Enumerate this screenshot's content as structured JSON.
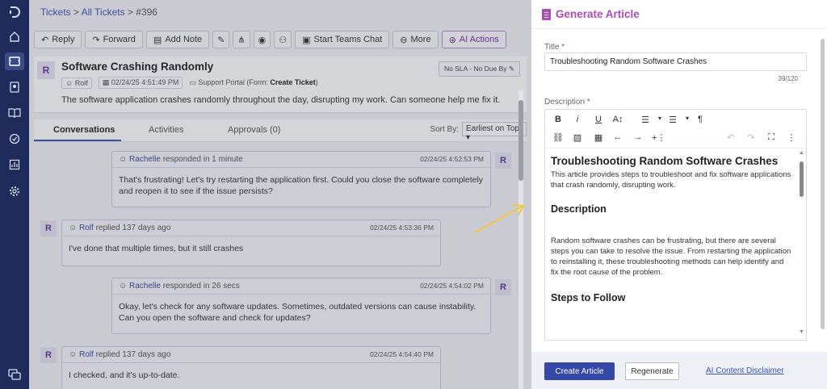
{
  "breadcrumb": {
    "tickets": "Tickets",
    "sep1": " > ",
    "all": "All Tickets",
    "sep2": " > ",
    "current": "#396"
  },
  "toolbar": {
    "reply": "Reply",
    "forward": "Forward",
    "add_note": "Add Note",
    "teams": "Start Teams Chat",
    "more": "More",
    "ai": "AI Actions"
  },
  "ticket": {
    "avatar": "R",
    "title": "Software Crashing Randomly",
    "requester": "Rolf",
    "created": "02/24/25 4:51:49 PM",
    "source_prefix": "Support Portal (Form: ",
    "source_form": "Create Ticket",
    "source_suffix": ")",
    "sla": "No SLA - No Due By",
    "description": "The software application crashes randomly throughout the day, disrupting my work. Can someone help me fix it."
  },
  "tabs": {
    "conversations": "Conversations",
    "activities": "Activities",
    "approvals": "Approvals (0)",
    "sort_label": "Sort By:",
    "sort_value": "Earliest on Top"
  },
  "messages": [
    {
      "avatar": "R",
      "name": "Rachelle",
      "action": " responded in 1 minute",
      "time": "02/24/25 4:52:53 PM",
      "body": "That's frustrating! Let's try restarting the application first. Could you close the software completely and reopen it to see if the issue persists?"
    },
    {
      "avatar": "R",
      "name": "Rolf",
      "action": " replied 137 days ago",
      "time": "02/24/25 4:53:36 PM",
      "body": "I've done that multiple times, but it still crashes"
    },
    {
      "avatar": "R",
      "name": "Rachelle",
      "action": " responded in 26 secs",
      "time": "02/24/25 4:54:02 PM",
      "body": "Okay, let's check for any software updates. Sometimes, outdated versions can cause instability. Can you open the software and check for updates?"
    },
    {
      "avatar": "R",
      "name": "Rolf",
      "action": " replied 137 days ago",
      "time": "02/24/25 4:54:40 PM",
      "body": "I checked, and it's up-to-date."
    }
  ],
  "panel": {
    "title": "Generate Article",
    "title_label": "Title *",
    "title_value": "Troubleshooting Random Software Crashes",
    "counter": "39/120",
    "description_label": "Description *",
    "editor": {
      "h1": "Troubleshooting Random Software Crashes",
      "intro": "This article provides steps to troubleshoot and fix software applications that crash randomly, disrupting work.",
      "h2a": "Description",
      "para": "Random software crashes can be frustrating, but there are several steps you can take to resolve the issue. From restarting the application to reinstalling it, these troubleshooting methods can help identify and fix the root cause of the problem.",
      "h2b": "Steps to Follow"
    },
    "create": "Create Article",
    "regenerate": "Regenerate",
    "disclaimer": "AI Content Disclaimer"
  },
  "colors": {
    "accent": "#b04ab8",
    "primary": "#3548a8",
    "rail": "#1f2b5a",
    "arrow": "#f2c744"
  }
}
